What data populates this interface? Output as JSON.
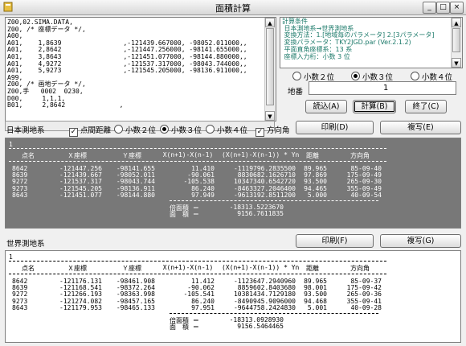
{
  "window": {
    "title": "面積計算",
    "min_label": "_",
    "max_label": "□",
    "close_label": "×"
  },
  "editor": {
    "lines": [
      "Z00,02.SIMA.DATA,",
      "Z00, /* 座標データ */,",
      "A00,",
      "A01,    1,8639                ,-121439.667000, -98052.011000,,",
      "A01,    2,8642                ,-121447.256000, -98141.655000,,",
      "A01,    3,8643                ,-121451.077000, -98144.880000,,",
      "A01,    4,9272                ,-121537.317000, -98043.744000,,",
      "A01,    5,9273                ,-121545.205000, -98136.911000,,",
      "A99,",
      "Z00, /* 画地データ */,",
      "Z00,手   0002  0230,",
      "D00,     1,1,1,",
      "B01,     2,8642              ,"
    ]
  },
  "info": {
    "lines": [
      "計算条件",
      " 日本測地系→世界測地系",
      " 変換方法：1.[地域毎のパラメータ] 2.[3パラメータ]",
      " 変換パラメータ：TKY2JGD.par (Ver.2.1.2)",
      " 平面直角座標系：13 系",
      " 座標入力桁：小数 3 位"
    ]
  },
  "options": {
    "radios": [
      "小数２位",
      "小数３位",
      "小数４位"
    ],
    "selected_index": 1,
    "chiban_label": "地番",
    "chiban_value": "1"
  },
  "buttons": {
    "read": "読込(A)",
    "calc": "計算(B)",
    "exit": "終了(C)",
    "print": "印刷(D)",
    "copy": "複写(E)",
    "print2": "印刷(F)",
    "copy2": "複写(G)"
  },
  "jp_row": {
    "label": "日本測地系",
    "distance_label": "点間距離",
    "distance_checked": true,
    "radios": [
      "小数２位",
      "小数３位",
      "小数４位"
    ],
    "selected_index": 1,
    "direction_label": "方向角",
    "direction_checked": true
  },
  "world_row": {
    "label": "世界測地系"
  },
  "columns": [
    "点名",
    "Ｘ座標",
    "Ｙ座標",
    "X(n+1)-X(n-1)",
    "(X(n+1)-X(n-1)) * Yn",
    "距離",
    "方向角"
  ],
  "jp_result": {
    "index": "1",
    "rows": [
      [
        "8642",
        "-121447.256",
        "-98141.655",
        "11.410",
        "-1119796.2835500",
        "89.965",
        "85-09-40"
      ],
      [
        "8639",
        "-121439.667",
        "-98052.011",
        "-90.061",
        "8830682.1626710",
        "97.869",
        "175-09-49"
      ],
      [
        "9272",
        "-121537.317",
        "-98043.744",
        "-105.538",
        "10347340.6542720",
        "93.500",
        "265-09-30"
      ],
      [
        "9273",
        "-121545.205",
        "-98136.911",
        "86.240",
        "-8463327.2046400",
        "94.465",
        "355-09-49"
      ],
      [
        "8643",
        "-121451.077",
        "-98144.880",
        "97.949",
        "-9613192.8511200",
        "5.000",
        "40-09-54"
      ]
    ],
    "area2_label": "倍面積 ＝",
    "area2_value": "-18313.5223670",
    "area_label": "面　積 ＝",
    "area_value": "9156.7611835"
  },
  "world_result": {
    "index": "1",
    "rows": [
      [
        "8642",
        "-121176.131",
        "-98461.908",
        "11.412",
        "-1123647.2940960",
        "89.965",
        "85-09-37"
      ],
      [
        "8639",
        "-121168.541",
        "-98372.264",
        "-90.062",
        "8859602.8403680",
        "98.001",
        "175-09-42"
      ],
      [
        "9272",
        "-121266.193",
        "-98363.998",
        "-105.541",
        "10381434.7129180",
        "93.500",
        "265-09-36"
      ],
      [
        "9273",
        "-121274.082",
        "-98457.165",
        "86.240",
        "-8490945.9096000",
        "94.468",
        "355-09-41"
      ],
      [
        "8643",
        "-121179.953",
        "-98465.133",
        "97.951",
        "-9644758.2424830",
        "5.001",
        "40-09-28"
      ]
    ],
    "area2_label": "倍面積 ＝",
    "area2_value": "-18313.0928930",
    "area_label": "面　積 ＝",
    "area_value": "9156.5464465"
  },
  "icons": {
    "app": "calculator-icon",
    "up": "▲",
    "down": "▼"
  }
}
